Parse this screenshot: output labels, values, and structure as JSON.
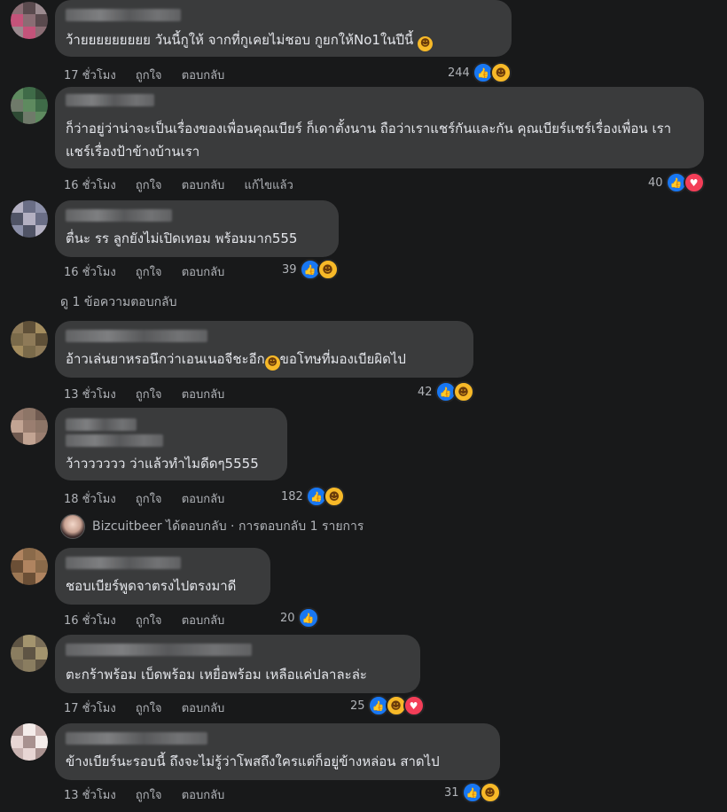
{
  "comments": [
    {
      "text": "ว้ายยยยยยยยย วันนี้กูให้ จากที่กูเคยไม่ชอบ กูยกให้No1ในปีนี้",
      "trailing_emoji": "haha-emoji",
      "time": "17 ชั่วโมง",
      "like": "ถูกใจ",
      "reply": "ตอบกลับ",
      "edited": "",
      "count": "244",
      "reactions": [
        "like",
        "haha"
      ],
      "avatar_colors": [
        "#8a6d74",
        "#c4537a",
        "#9b8a8f",
        "#5a4a4e"
      ]
    },
    {
      "text": "ก็ว่าอยู่ว่าน่าจะเป็นเรื่องของเพื่อนคุณเบียร์ ก็เดาตั้งนาน ถือว่าเราแชร์กันและกัน คุณเบียร์แชร์เรื่องเพื่อน เราแชร์เรื่องป้าข้างบ้านเรา",
      "trailing_emoji": "",
      "time": "16 ชั่วโมง",
      "like": "ถูกใจ",
      "reply": "ตอบกลับ",
      "edited": "แก้ไขแล้ว",
      "count": "40",
      "reactions": [
        "like",
        "love"
      ],
      "avatar_colors": [
        "#3f6b48",
        "#5e8a5f",
        "#6f7a6a",
        "#2e4a34"
      ]
    },
    {
      "text": "ตื่นะ รร ลูกยังไม่เปิดเทอม พร้อมมาก555",
      "trailing_emoji": "",
      "time": "16 ชั่วโมง",
      "like": "ถูกใจ",
      "reply": "ตอบกลับ",
      "edited": "",
      "count": "39",
      "reactions": [
        "like",
        "haha"
      ],
      "avatar_colors": [
        "#8b8fa8",
        "#6a6e86",
        "#b3b0c2",
        "#505466"
      ]
    },
    {
      "text": "อ้าวเล่นยาหรอนึกว่าเอนเนอจีชะอีก",
      "trailing_emoji": "haha-emoji",
      "text_after": "ขอโทษที่มองเบียผิดไป",
      "time": "13 ชั่วโมง",
      "like": "ถูกใจ",
      "reply": "ตอบกลับ",
      "edited": "",
      "count": "42",
      "reactions": [
        "like",
        "haha"
      ],
      "avatar_colors": [
        "#7a6a4a",
        "#a38c5e",
        "#5f5038",
        "#8e7a58"
      ]
    },
    {
      "text": "ว้าวววววว ว่าแล้วทำไมดีดๆ5555",
      "trailing_emoji": "",
      "time": "18 ชั่วโมง",
      "like": "ถูกใจ",
      "reply": "ตอบกลับ",
      "edited": "",
      "count": "182",
      "reactions": [
        "like",
        "haha"
      ],
      "avatar_colors": [
        "#9a7e70",
        "#c2a493",
        "#6f5a50",
        "#8d7567"
      ]
    },
    {
      "text": "ชอบเบียร์พูดจาตรงไปตรงมาดี",
      "trailing_emoji": "",
      "time": "16 ชั่วโมง",
      "like": "ถูกใจ",
      "reply": "ตอบกลับ",
      "edited": "",
      "count": "20",
      "reactions": [
        "like"
      ],
      "avatar_colors": [
        "#8a6a4a",
        "#b08460",
        "#6b4f36",
        "#9c7754"
      ]
    },
    {
      "text": "ตะกร้าพร้อม เบ็ดพร้อม เหยื่อพร้อม เหลือแค่ปลาละล่ะ",
      "trailing_emoji": "",
      "time": "17 ชั่วโมง",
      "like": "ถูกใจ",
      "reply": "ตอบกลับ",
      "edited": "",
      "count": "25",
      "reactions": [
        "like",
        "haha",
        "love"
      ],
      "avatar_colors": [
        "#7a6e58",
        "#a3946e",
        "#5e5444",
        "#8a7d60"
      ]
    },
    {
      "text": "ข้างเบียร์นะรอบนี้ ถึงจะไม่รู้ว่าโพสถึงใครแต่ก็อยู่ข้างหล่อน สาดไป",
      "trailing_emoji": "",
      "time": "13 ชั่วโมง",
      "like": "ถูกใจ",
      "reply": "ตอบกลับ",
      "edited": "",
      "count": "31",
      "reactions": [
        "like",
        "haha"
      ],
      "avatar_colors": [
        "#e8d6d4",
        "#c9b3b1",
        "#f4ecea",
        "#a8918f"
      ]
    }
  ],
  "see_replies": "ดู 1 ข้อความตอบกลับ",
  "replied_line": {
    "name": "Bizcuitbeer",
    "action": "ได้ตอบกลับ",
    "separator": "·",
    "summary": "การตอบกลับ 1 รายการ"
  },
  "icons": {
    "like": "thumbs-up-icon",
    "haha": "laughing-face-icon",
    "love": "heart-icon"
  },
  "colors": {
    "background": "#18191a",
    "bubble": "#3a3b3c",
    "like_blue": "#1877f2",
    "haha_yellow": "#f7b928",
    "love_red": "#f33e58",
    "meta_text": "#b0b3b8"
  }
}
